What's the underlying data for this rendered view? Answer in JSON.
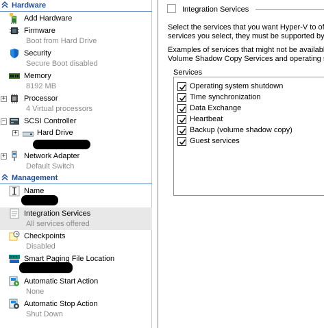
{
  "hardware_section": {
    "title": "Hardware"
  },
  "hardware_items": [
    {
      "label": "Add Hardware",
      "sub": ""
    },
    {
      "label": "Firmware",
      "sub": "Boot from Hard Drive"
    },
    {
      "label": "Security",
      "sub": "Secure Boot disabled"
    },
    {
      "label": "Memory",
      "sub": "8192 MB"
    },
    {
      "label": "Processor",
      "sub": "4 Virtual processors"
    },
    {
      "label": "SCSI Controller",
      "sub": ""
    },
    {
      "label": "Hard Drive",
      "sub": ""
    },
    {
      "label": "Network Adapter",
      "sub": "Default Switch"
    }
  ],
  "management_section": {
    "title": "Management"
  },
  "management_items": [
    {
      "label": "Name",
      "sub": ""
    },
    {
      "label": "Integration Services",
      "sub": "All services offered"
    },
    {
      "label": "Checkpoints",
      "sub": "Disabled"
    },
    {
      "label": "Smart Paging File Location",
      "sub": ""
    },
    {
      "label": "Automatic Start Action",
      "sub": "None"
    },
    {
      "label": "Automatic Stop Action",
      "sub": "Shut Down"
    }
  ],
  "details": {
    "group_title": "Integration Services",
    "desc_line1": "Select the services that you want Hyper-V to of",
    "desc_line2": "services you select, they must be supported by",
    "examples_line1": "Examples of services that might not be available",
    "examples_line2": "Volume Shadow Copy Services and operating sy",
    "services_label": "Services",
    "services": [
      {
        "label": "Operating system shutdown",
        "checked": true
      },
      {
        "label": "Time synchronization",
        "checked": true
      },
      {
        "label": "Data Exchange",
        "checked": true
      },
      {
        "label": "Heartbeat",
        "checked": true
      },
      {
        "label": "Backup (volume shadow copy)",
        "checked": true
      },
      {
        "label": "Guest services",
        "checked": true
      }
    ]
  },
  "colors": {
    "section_title": "#1f4e9c",
    "secondary_text": "#8a8a8a",
    "selected_row": "#e8e8e8"
  }
}
